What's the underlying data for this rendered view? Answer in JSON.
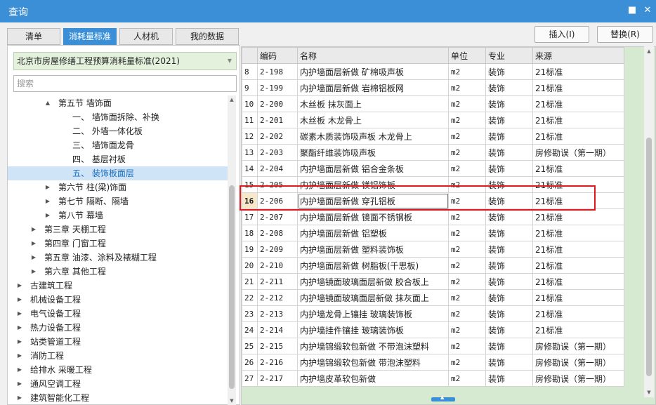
{
  "window": {
    "title": "查询"
  },
  "tabs": [
    {
      "label": "清单"
    },
    {
      "label": "消耗量标准"
    },
    {
      "label": "人材机"
    },
    {
      "label": "我的数据"
    }
  ],
  "buttons": {
    "insert": "插入(I)",
    "replace": "替换(R)"
  },
  "left": {
    "standard_select": "北京市房屋修缮工程预算消耗量标准(2021)",
    "search_placeholder": "搜索",
    "tree": [
      {
        "label": "第五节 墙饰面",
        "toggle": "▲"
      },
      {
        "label": "一、 墙饰面拆除、补换",
        "toggle": ""
      },
      {
        "label": "二、 外墙一体化板",
        "toggle": ""
      },
      {
        "label": "三、 墙饰面龙骨",
        "toggle": ""
      },
      {
        "label": "四、 基层衬板",
        "toggle": ""
      },
      {
        "label": "五、 装饰板面层",
        "toggle": ""
      },
      {
        "label": "第六节 柱(梁)饰面",
        "toggle": "▶"
      },
      {
        "label": "第七节 隔断、隔墙",
        "toggle": "▶"
      },
      {
        "label": "第八节 幕墙",
        "toggle": "▶"
      },
      {
        "label": "第三章 天棚工程",
        "toggle": "▶"
      },
      {
        "label": "第四章 门窗工程",
        "toggle": "▶"
      },
      {
        "label": "第五章 油漆、涂料及裱糊工程",
        "toggle": "▶"
      },
      {
        "label": "第六章 其他工程",
        "toggle": "▶"
      },
      {
        "label": "古建筑工程",
        "toggle": "▶"
      },
      {
        "label": "机械设备工程",
        "toggle": "▶"
      },
      {
        "label": "电气设备工程",
        "toggle": "▶"
      },
      {
        "label": "热力设备工程",
        "toggle": "▶"
      },
      {
        "label": "站类管道工程",
        "toggle": "▶"
      },
      {
        "label": "消防工程",
        "toggle": "▶"
      },
      {
        "label": "给排水 采暖工程",
        "toggle": "▶"
      },
      {
        "label": "通风空调工程",
        "toggle": "▶"
      },
      {
        "label": "建筑智能化工程",
        "toggle": "▶"
      }
    ]
  },
  "grid": {
    "columns": [
      "",
      "编码",
      "名称",
      "单位",
      "专业",
      "来源"
    ],
    "rows": [
      {
        "num": "8",
        "code": "2-198",
        "name": "内护墙面层新做 矿棉吸声板",
        "unit": "m2",
        "major": "装饰",
        "source": "21标准"
      },
      {
        "num": "9",
        "code": "2-199",
        "name": "内护墙面层新做 岩棉铝板网",
        "unit": "m2",
        "major": "装饰",
        "source": "21标准"
      },
      {
        "num": "10",
        "code": "2-200",
        "name": "木丝板 抹灰面上",
        "unit": "m2",
        "major": "装饰",
        "source": "21标准"
      },
      {
        "num": "11",
        "code": "2-201",
        "name": "木丝板 木龙骨上",
        "unit": "m2",
        "major": "装饰",
        "source": "21标准"
      },
      {
        "num": "12",
        "code": "2-202",
        "name": "碳素木质装饰吸声板 木龙骨上",
        "unit": "m2",
        "major": "装饰",
        "source": "21标准"
      },
      {
        "num": "13",
        "code": "2-203",
        "name": "聚酯纤维装饰吸声板",
        "unit": "m2",
        "major": "装饰",
        "source": "房修勘误（第一期）"
      },
      {
        "num": "14",
        "code": "2-204",
        "name": "内护墙面层新做 铝合金条板",
        "unit": "m2",
        "major": "装饰",
        "source": "21标准"
      },
      {
        "num": "15",
        "code": "2-205",
        "name": "内护墙面层新做 镁铝饰板",
        "unit": "m2",
        "major": "装饰",
        "source": "21标准"
      },
      {
        "num": "16",
        "code": "2-206",
        "name": "内护墙面层新做 穿孔铝板",
        "unit": "m2",
        "major": "装饰",
        "source": "21标准"
      },
      {
        "num": "17",
        "code": "2-207",
        "name": "内护墙面层新做 镜面不锈钢板",
        "unit": "m2",
        "major": "装饰",
        "source": "21标准"
      },
      {
        "num": "18",
        "code": "2-208",
        "name": "内护墙面层新做 铝塑板",
        "unit": "m2",
        "major": "装饰",
        "source": "21标准"
      },
      {
        "num": "19",
        "code": "2-209",
        "name": "内护墙面层新做 塑料装饰板",
        "unit": "m2",
        "major": "装饰",
        "source": "21标准"
      },
      {
        "num": "20",
        "code": "2-210",
        "name": "内护墙面层新做 树脂板(千思板)",
        "unit": "m2",
        "major": "装饰",
        "source": "21标准"
      },
      {
        "num": "21",
        "code": "2-211",
        "name": "内护墙镜面玻璃面层新做 胶合板上",
        "unit": "m2",
        "major": "装饰",
        "source": "21标准"
      },
      {
        "num": "22",
        "code": "2-212",
        "name": "内护墙镜面玻璃面层新做 抹灰面上",
        "unit": "m2",
        "major": "装饰",
        "source": "21标准"
      },
      {
        "num": "23",
        "code": "2-213",
        "name": "内护墙龙骨上镶挂 玻璃装饰板",
        "unit": "m2",
        "major": "装饰",
        "source": "21标准"
      },
      {
        "num": "24",
        "code": "2-214",
        "name": "内护墙挂件镶挂 玻璃装饰板",
        "unit": "m2",
        "major": "装饰",
        "source": "21标准"
      },
      {
        "num": "25",
        "code": "2-215",
        "name": "内护墙锦缎软包新做 不带泡沫塑料",
        "unit": "m2",
        "major": "装饰",
        "source": "房修勘误（第一期）"
      },
      {
        "num": "26",
        "code": "2-216",
        "name": "内护墙锦缎软包新做 带泡沫塑料",
        "unit": "m2",
        "major": "装饰",
        "source": "房修勘误（第一期）"
      },
      {
        "num": "27",
        "code": "2-217",
        "name": "内护墙皮革软包新做",
        "unit": "m2",
        "major": "装饰",
        "source": "房修勘误（第一期）"
      }
    ]
  },
  "colors": {
    "accent": "#3b8fd6",
    "highlight": "#e0191f",
    "select_bg": "#e4f2dd"
  },
  "icons": {
    "maximize": "maximize-icon",
    "close": "close-icon"
  }
}
